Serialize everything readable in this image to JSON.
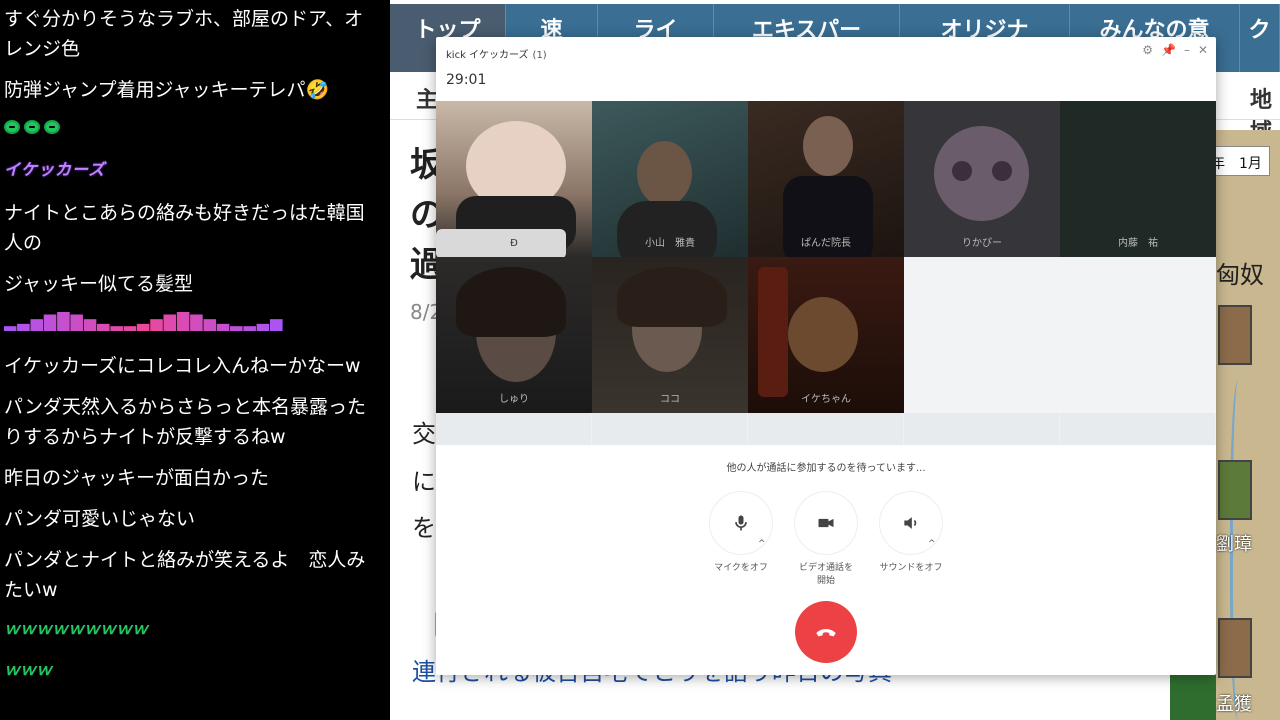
{
  "chat": {
    "messages": [
      "すぐ分かりそうなラブホ、部屋のドア、オレンジ色",
      "防弾ジャンプ着用ジャッキーテレパ🤣",
      "ナイトとこあらの絡みも好きだっはた韓国人の",
      "ジャッキー似てる髪型",
      "イケッカーズにコレコレ入んねーかなーw",
      "パンダ天然入るからさらっと本名暴露ったりするからナイトが反撃するねw",
      "昨日のジャッキーが面白かった",
      "パンダ可愛いじゃない",
      "パンダとナイトと絡みが笑えるよ　恋人みたいw"
    ],
    "emote_text_1": "イケッカーズ",
    "emote_mm_1": "ｗｗｗｗｗｗｗｗｗ",
    "emote_mm_2": "ｗｗｗ"
  },
  "page": {
    "nav": [
      "トップ",
      "速",
      "ライ",
      "エキスパー",
      "オリジナ",
      "みんなの意",
      "ク"
    ],
    "subnav_left": "主",
    "subnav_right": "地域",
    "title_chars": "坂の過",
    "date": "8/2",
    "body_chars": [
      "交",
      "に",
      "を"
    ],
    "bracket": "【",
    "link_text": "連行される被告自宅でとりを語り昨日の写真"
  },
  "game": {
    "month": "年　1月",
    "kanji": "匈奴",
    "kanji2": "劉璋",
    "kanji3": "孟獲"
  },
  "discord": {
    "title": "kick イケッカーズ",
    "count": "(1)",
    "timer": "29:01",
    "participants": [
      {
        "name": "Ð"
      },
      {
        "name": "小山　雅貴"
      },
      {
        "name": "ぱんだ院長"
      },
      {
        "name": "りかぴー"
      },
      {
        "name": "内藤　祐"
      },
      {
        "name": "しゅり"
      },
      {
        "name": "ココ"
      },
      {
        "name": "イケちゃん"
      }
    ],
    "waiting_text": "他の人が通話に参加するのを待っています...",
    "mic_label": "マイクをオフ",
    "video_label_1": "ビデオ通話を",
    "video_label_2": "開始",
    "sound_label": "サウンドをオフ",
    "colors": {
      "hangup": "#ed4245",
      "accent": "#3a6e93"
    }
  }
}
